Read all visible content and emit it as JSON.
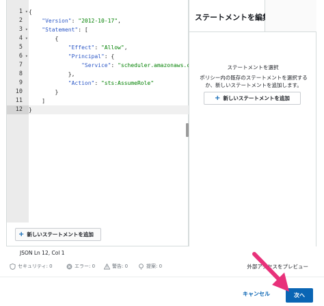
{
  "editor": {
    "lines": [
      {
        "num": "1",
        "fold": "▾",
        "parts": [
          {
            "t": "p",
            "v": "{"
          }
        ]
      },
      {
        "num": "2",
        "fold": "",
        "parts": [
          {
            "t": "p",
            "v": "    "
          },
          {
            "t": "k",
            "v": "\"Version\""
          },
          {
            "t": "p",
            "v": ": "
          },
          {
            "t": "s",
            "v": "\"2012-10-17\""
          },
          {
            "t": "p",
            "v": ","
          }
        ]
      },
      {
        "num": "3",
        "fold": "▾",
        "parts": [
          {
            "t": "p",
            "v": "    "
          },
          {
            "t": "k",
            "v": "\"Statement\""
          },
          {
            "t": "p",
            "v": ": ["
          }
        ]
      },
      {
        "num": "4",
        "fold": "▾",
        "parts": [
          {
            "t": "p",
            "v": "        {"
          }
        ]
      },
      {
        "num": "5",
        "fold": "",
        "parts": [
          {
            "t": "p",
            "v": "            "
          },
          {
            "t": "k",
            "v": "\"Effect\""
          },
          {
            "t": "p",
            "v": ": "
          },
          {
            "t": "s",
            "v": "\"Allow\""
          },
          {
            "t": "p",
            "v": ","
          }
        ]
      },
      {
        "num": "6",
        "fold": "▾",
        "parts": [
          {
            "t": "p",
            "v": "            "
          },
          {
            "t": "k",
            "v": "\"Principal\""
          },
          {
            "t": "p",
            "v": ": {"
          }
        ]
      },
      {
        "num": "7",
        "fold": "",
        "parts": [
          {
            "t": "p",
            "v": "                "
          },
          {
            "t": "k",
            "v": "\"Service\""
          },
          {
            "t": "p",
            "v": ": "
          },
          {
            "t": "s",
            "v": "\"scheduler.amazonaws.com\""
          }
        ]
      },
      {
        "num": "8",
        "fold": "",
        "parts": [
          {
            "t": "p",
            "v": "            },"
          }
        ]
      },
      {
        "num": "9",
        "fold": "",
        "parts": [
          {
            "t": "p",
            "v": "            "
          },
          {
            "t": "k",
            "v": "\"Action\""
          },
          {
            "t": "p",
            "v": ": "
          },
          {
            "t": "s",
            "v": "\"sts:AssumeRole\""
          }
        ]
      },
      {
        "num": "10",
        "fold": "",
        "parts": [
          {
            "t": "p",
            "v": "        }"
          }
        ]
      },
      {
        "num": "11",
        "fold": "",
        "parts": [
          {
            "t": "p",
            "v": "    ]"
          }
        ]
      },
      {
        "num": "12",
        "fold": "",
        "parts": [
          {
            "t": "p",
            "v": "}"
          }
        ]
      }
    ],
    "active_line": 12,
    "add_statement_label": "新しいステートメントを追加"
  },
  "panel": {
    "title": "ステートメントを編集",
    "heading": "ステートメントを選択",
    "description": "ポリシー内の既存のステートメントを選択するか、新しいステートメントを追加します。",
    "add_statement_label": "新しいステートメントを追加"
  },
  "status": {
    "text": "JSON   Ln 12, Col 1"
  },
  "validation": {
    "security": "セキュリティ: 0",
    "errors": "エラー: 0",
    "warnings": "警告: 0",
    "suggestions": "提案: 0",
    "preview_link": "外部アクセスをプレビュー"
  },
  "footer": {
    "cancel_label": "キャンセル",
    "next_label": "次へ"
  },
  "colors": {
    "accent": "#0a65b4",
    "arrow": "#e8317a",
    "json_key": "#2a56c6",
    "json_string": "#008000"
  },
  "icons": {
    "add": "plus-icon",
    "security": "shield-icon",
    "error": "x-circle-icon",
    "warning": "warning-triangle-icon",
    "suggestion": "lightbulb-icon",
    "annotation": "pink-arrow-icon"
  }
}
